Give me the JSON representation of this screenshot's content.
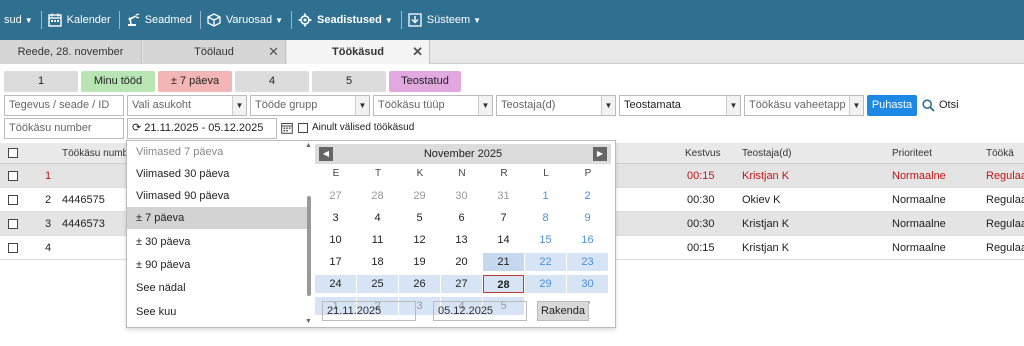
{
  "nav": {
    "items": [
      {
        "label": "sud",
        "icon": "",
        "chevron": true
      },
      {
        "label": "Kalender",
        "icon": "calendar-icon",
        "chevron": false
      },
      {
        "label": "Seadmed",
        "icon": "robot-arm-icon",
        "chevron": false
      },
      {
        "label": "Varuosad",
        "icon": "box-icon",
        "chevron": true
      },
      {
        "label": "Seadistused",
        "icon": "gear-icon",
        "chevron": true
      },
      {
        "label": "Süsteem",
        "icon": "download-icon",
        "chevron": true
      }
    ],
    "bg_color": "#2f6f8f"
  },
  "tabs": [
    {
      "label": "Reede, 28. november",
      "closable": false
    },
    {
      "label": "Töölaud",
      "closable": true
    },
    {
      "label": "Töökäsud",
      "closable": true
    }
  ],
  "filter_buttons": [
    {
      "label": "1",
      "color": "#dcdcdc"
    },
    {
      "label": "Minu tööd",
      "color": "#b9e5b5"
    },
    {
      "label": "± 7 päeva",
      "color": "#f3b5b5"
    },
    {
      "label": "4",
      "color": "#dcdcdc"
    },
    {
      "label": "5",
      "color": "#dcdcdc"
    },
    {
      "label": "Teostatud",
      "color": "#e2a8e0"
    }
  ],
  "filters": {
    "activity_placeholder": "Tegevus / seade / ID",
    "location_placeholder": "Vali asukoht",
    "group_placeholder": "Tööde grupp",
    "type_placeholder": "Töökäsu tüüp",
    "performer_placeholder": "Teostaja(d)",
    "status_value": "Teostamata",
    "stage_placeholder": "Töökäsu vaheetapp",
    "clear_button": "Puhasta",
    "search_label": "Otsi",
    "number_placeholder": "Töökäsu number",
    "date_range_value": "21.11.2025 - 05.12.2025",
    "external_only_label": "Ainult välised töökäsud"
  },
  "table": {
    "headers": {
      "number": "Töökäsu numbe",
      "duration": "Kestvus",
      "performer": "Teostaja(d)",
      "priority": "Prioriteet",
      "type": "Töökä"
    },
    "rows": [
      {
        "idx": "1",
        "number": "",
        "duration": "00:15",
        "performer": "Kristjan K",
        "priority": "Normaalne",
        "type": "Regulaa",
        "highlight": true
      },
      {
        "idx": "2",
        "number": "4446575",
        "duration": "00:30",
        "performer": "Okiev K",
        "priority": "Normaalne",
        "type": "Regulaa",
        "highlight": false
      },
      {
        "idx": "3",
        "number": "4446573",
        "duration": "00:30",
        "performer": "Kristjan K",
        "priority": "Normaalne",
        "type": "Regulaa",
        "highlight": false
      },
      {
        "idx": "4",
        "number": "",
        "duration": "00:15",
        "performer": "Kristjan K",
        "priority": "Normaalne",
        "type": "Regulaa",
        "highlight": false
      }
    ]
  },
  "range_menu": {
    "items": [
      "Viimased 7 päeva",
      "Viimased 30 päeva",
      "Viimased 90 päeva",
      "± 7 päeva",
      "± 30 päeva",
      "± 90 päeva",
      "See nädal",
      "See kuu"
    ],
    "selected_index": 3
  },
  "calendar": {
    "month_label": "November 2025",
    "weekdays": [
      "E",
      "T",
      "K",
      "N",
      "R",
      "L",
      "P"
    ],
    "weeks": [
      [
        "27",
        "28",
        "29",
        "30",
        "31",
        "1",
        "2"
      ],
      [
        "3",
        "4",
        "5",
        "6",
        "7",
        "8",
        "9"
      ],
      [
        "10",
        "11",
        "12",
        "13",
        "14",
        "15",
        "16"
      ],
      [
        "17",
        "18",
        "19",
        "20",
        "21",
        "22",
        "23"
      ],
      [
        "24",
        "25",
        "26",
        "27",
        "28",
        "29",
        "30"
      ],
      [
        "1",
        "2",
        "3",
        "4",
        "5",
        "6",
        "7"
      ]
    ],
    "start_input": "21.11.2025",
    "end_input": "05.12.2025",
    "apply_label": "Rakenda"
  }
}
